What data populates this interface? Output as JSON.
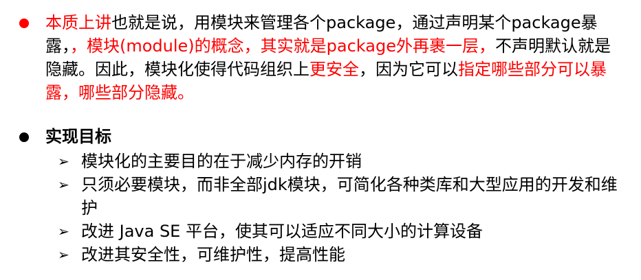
{
  "colors": {
    "accent_red": "#ff0000",
    "text_black": "#000000"
  },
  "section1": {
    "segments": [
      {
        "text": "本质上讲",
        "color": "red"
      },
      {
        "text": "也就是说，用模块来管理各个package，通过声明某个package暴露，",
        "color": "black"
      },
      {
        "text": "，模块(module)的概念，其实就是package外再裹一层，",
        "color": "red"
      },
      {
        "text": "不声明默认就是隐藏。因此，模块化使得代码组织上",
        "color": "black"
      },
      {
        "text": "更安全",
        "color": "red"
      },
      {
        "text": "，因为它可以",
        "color": "black"
      },
      {
        "text": "指定哪些部分可以暴露，哪些部分隐藏。",
        "color": "red"
      }
    ]
  },
  "section2": {
    "heading": "实现目标",
    "items": [
      {
        "text": "模块化的主要目的在于减少内存的开销"
      },
      {
        "text": "只须必要模块，而非全部jdk模块，可简化各种类库和大型应用的开发和维护"
      },
      {
        "text": "改进 Java SE 平台，使其可以适应不同大小的计算设备"
      },
      {
        "text": "改进其安全性，可维护性，提高性能"
      }
    ]
  },
  "icons": {
    "bullet_red": "filled-circle",
    "bullet_black": "filled-circle",
    "sub_bullet": "arrowhead"
  }
}
